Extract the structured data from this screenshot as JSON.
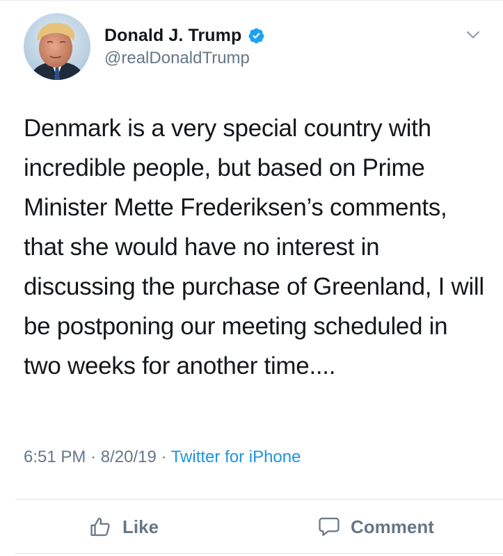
{
  "tweet": {
    "author": {
      "display_name": "Donald J. Trump",
      "handle": "@realDonaldTrump",
      "verified": true
    },
    "text": "Denmark is a very special country with incredible people, but based on Prime Minister Mette Frederiksen’s comments, that she would have no interest in discussing the purchase of Greenland, I will be postponing our meeting scheduled in two weeks for another time....",
    "time": "6:51 PM",
    "separator": "·",
    "date": "8/20/19",
    "source": "Twitter for iPhone"
  },
  "actions": {
    "like_label": "Like",
    "comment_label": "Comment"
  },
  "icons": {
    "verified": "verified-badge-icon",
    "menu": "chevron-down-icon",
    "like": "thumbs-up-icon",
    "comment": "speech-bubble-icon"
  },
  "colors": {
    "text": "#14171a",
    "muted": "#657786",
    "link": "#1b95e0",
    "verified": "#1da1f2"
  }
}
